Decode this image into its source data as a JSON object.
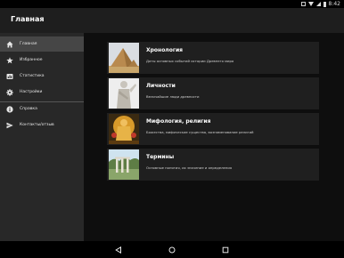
{
  "status_bar": {
    "time": "8:42"
  },
  "app_bar": {
    "title": "Главная"
  },
  "drawer": {
    "items": [
      {
        "label": "Главная",
        "icon": "home-icon"
      },
      {
        "label": "Избранное",
        "icon": "star-icon"
      },
      {
        "label": "Статистика",
        "icon": "statistics-icon"
      },
      {
        "label": "Настройки",
        "icon": "gear-icon"
      },
      {
        "label": "Справка",
        "icon": "info-icon"
      },
      {
        "label": "Контакты/отзыв",
        "icon": "send-icon"
      }
    ]
  },
  "cards": [
    {
      "title": "Хронология",
      "description": "Даты основных событий истории Древнего мира"
    },
    {
      "title": "Личности",
      "description": "Величайшие люди древности"
    },
    {
      "title": "Мифология, религия",
      "description": "Божества, мифические существа, вознаменование религий"
    },
    {
      "title": "Термины",
      "description": "Основные понятия, их значение и определения"
    }
  ],
  "colors": {
    "app_bar": "#1e1e1e",
    "drawer": "#282828",
    "drawer_active": "#464646",
    "card": "#1f1f1f",
    "content": "#0e0e0e"
  }
}
